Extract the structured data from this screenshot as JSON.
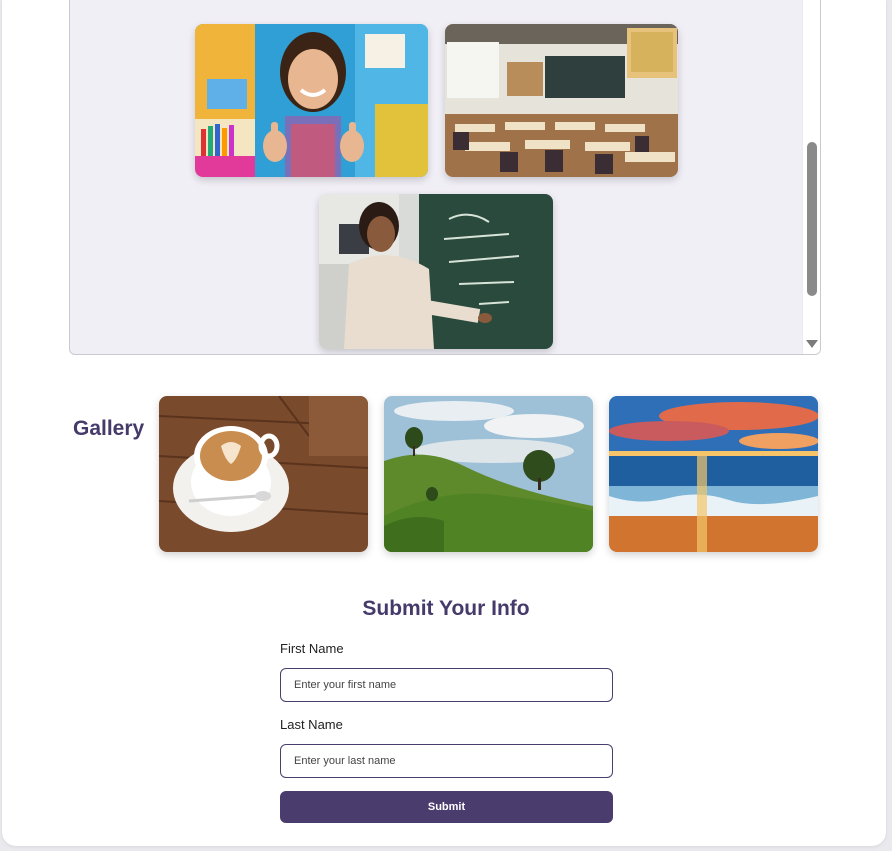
{
  "gallery": {
    "title": "Gallery",
    "images": [
      "coffee-latte-photo",
      "green-hills-photo",
      "ocean-sunset-photo"
    ]
  },
  "top_photos": [
    "girl-thumbs-up-photo",
    "classroom-photo",
    "teacher-chalkboard-photo"
  ],
  "form": {
    "title": "Submit Your Info",
    "first_name": {
      "label": "First Name",
      "placeholder": "Enter your first name"
    },
    "last_name": {
      "label": "Last Name",
      "placeholder": "Enter your last name"
    },
    "submit_label": "Submit"
  },
  "colors": {
    "accent": "#463a6b",
    "button": "#4b3c6e",
    "scrollbox_bg": "#f1eff6"
  }
}
